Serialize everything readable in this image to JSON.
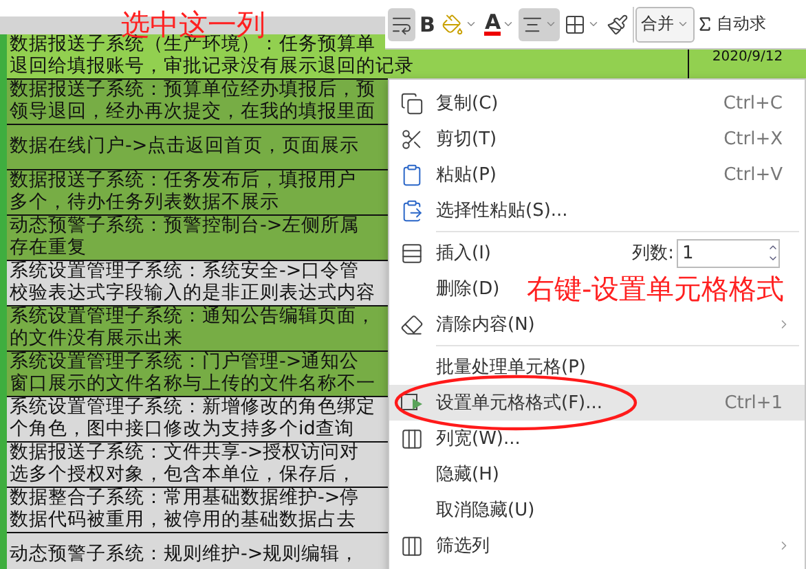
{
  "column_header": {
    "annotation": "选中这一列"
  },
  "toolbar": {
    "buttons": [
      {
        "kind": "wrap",
        "selected": true
      },
      {
        "kind": "bold",
        "label": "B",
        "selected": false
      },
      {
        "kind": "fill",
        "selected": false
      },
      {
        "kind": "font_color",
        "label": "A",
        "selected": false
      },
      {
        "kind": "align",
        "selected": true
      },
      {
        "kind": "border",
        "selected": false
      },
      {
        "kind": "painter",
        "selected": false
      }
    ],
    "merge": {
      "label": "合并"
    },
    "autosum": {
      "label": "自动求"
    }
  },
  "rows": [
    {
      "color": "#92d050",
      "lines": [
        "数据报送子系统（生产环境）：任务预算单",
        "退回给填报账号，审批记录没有展示退回的记录"
      ],
      "date": "2020/9/12"
    },
    {
      "color": "#77ad45",
      "lines": [
        "数据报送子系统：预算单位经办填报后，预",
        "领导退回，经办再次提交，在我的填报里面"
      ]
    },
    {
      "color": "#77ad45",
      "lines": [
        "数据在线门户->点击返回首页，页面展示"
      ]
    },
    {
      "color": "#77ad45",
      "lines": [
        "数据报送子系统：任务发布后，填报用户",
        "多个，待办任务列表数据不展示"
      ]
    },
    {
      "color": "#77ad45",
      "lines": [
        "动态预警子系统：预警控制台->左侧所属",
        "存在重复"
      ]
    },
    {
      "color": "#d9d9d9",
      "lines": [
        "系统设置管理子系统：系统安全->口令管",
        "校验表达式字段输入的是非正则表达式内容"
      ]
    },
    {
      "color": "#77ad45",
      "lines": [
        "系统设置管理子系统：通知公告编辑页面，",
        "的文件没有展示出来"
      ]
    },
    {
      "color": "#77ad45",
      "lines": [
        "系统设置管理子系统：门户管理->通知公",
        "窗口展示的文件名称与上传的文件名称不一"
      ]
    },
    {
      "color": "#d9d9d9",
      "lines": [
        "系统设置管理子系统：新增修改的角色绑定",
        "个角色，图中接口修改为支持多个id查询"
      ]
    },
    {
      "color": "#d9d9d9",
      "lines": [
        "数据报送子系统：文件共享->授权访问对",
        "选多个授权对象，包含本单位，保存后，"
      ]
    },
    {
      "color": "#d9d9d9",
      "lines": [
        "数据整合子系统：常用基础数据维护->停",
        "数据代码被重用，被停用的基础数据占去"
      ]
    },
    {
      "color": "#d9d9d9",
      "lines": [
        "动态预警子系统：规则维护->规则编辑，"
      ]
    }
  ],
  "context_menu": {
    "annotation": "右键-设置单元格格式",
    "items": [
      {
        "kind": "item",
        "label": "复制(C)",
        "shortcut": "Ctrl+C",
        "selected": false
      },
      {
        "kind": "item",
        "label": "剪切(T)",
        "shortcut": "Ctrl+X",
        "selected": false
      },
      {
        "kind": "item",
        "label": "粘贴(P)",
        "shortcut": "Ctrl+V",
        "selected": false
      },
      {
        "kind": "item",
        "label": "选择性粘贴(S)...",
        "selected": false
      },
      {
        "kind": "separator"
      },
      {
        "kind": "insert",
        "label": "插入(I)",
        "count_label": "列数:",
        "count_value": "1",
        "selected": false
      },
      {
        "kind": "item",
        "label": "删除(D)",
        "selected": false
      },
      {
        "kind": "item",
        "label": "清除内容(N)",
        "submenu": true,
        "selected": false
      },
      {
        "kind": "separator"
      },
      {
        "kind": "item",
        "label": "批量处理单元格(P)",
        "selected": false
      },
      {
        "kind": "item",
        "label": "设置单元格格式(F)...",
        "shortcut": "Ctrl+1",
        "selected": true,
        "circled": true
      },
      {
        "kind": "item",
        "label": "列宽(W)...",
        "selected": false
      },
      {
        "kind": "item",
        "label": "隐藏(H)",
        "selected": false
      },
      {
        "kind": "item",
        "label": "取消隐藏(U)",
        "selected": false
      },
      {
        "kind": "item",
        "label": "筛选列",
        "submenu": true,
        "selected": false
      }
    ]
  }
}
